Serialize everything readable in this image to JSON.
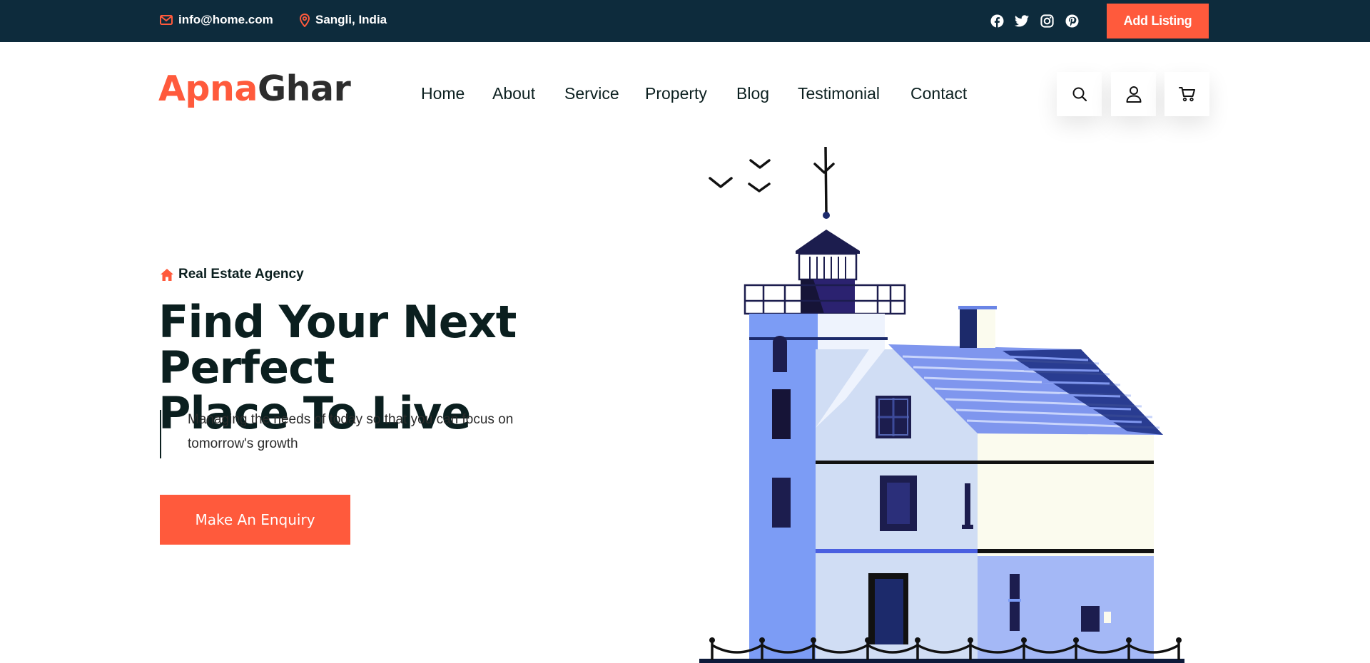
{
  "topbar": {
    "email": "info@home.com",
    "location": "Sangli, India",
    "add_listing_label": "Add Listing",
    "social_icons": [
      "facebook-icon",
      "twitter-icon",
      "instagram-icon",
      "pinterest-icon"
    ]
  },
  "logo": {
    "part1": "Apna",
    "part2": "Ghar"
  },
  "nav": {
    "items": [
      "Home",
      "About",
      "Service",
      "Property",
      "Blog",
      "Testimonial",
      "Contact"
    ],
    "action_icons": [
      "search-icon",
      "user-icon",
      "cart-icon"
    ]
  },
  "hero": {
    "tagline": "Real Estate Agency",
    "headline_line1": "Find Your Next Perfect",
    "headline_line2": "Place To Live",
    "description_line1": "Managing the needs of today so that you can focus on",
    "description_line2": "tomorrow's growth",
    "cta_label": "Make An Enquiry"
  },
  "colors": {
    "accent": "#ff5a3c",
    "topbar_bg": "#0d2b3c",
    "text_dark": "#0b1f1f"
  }
}
